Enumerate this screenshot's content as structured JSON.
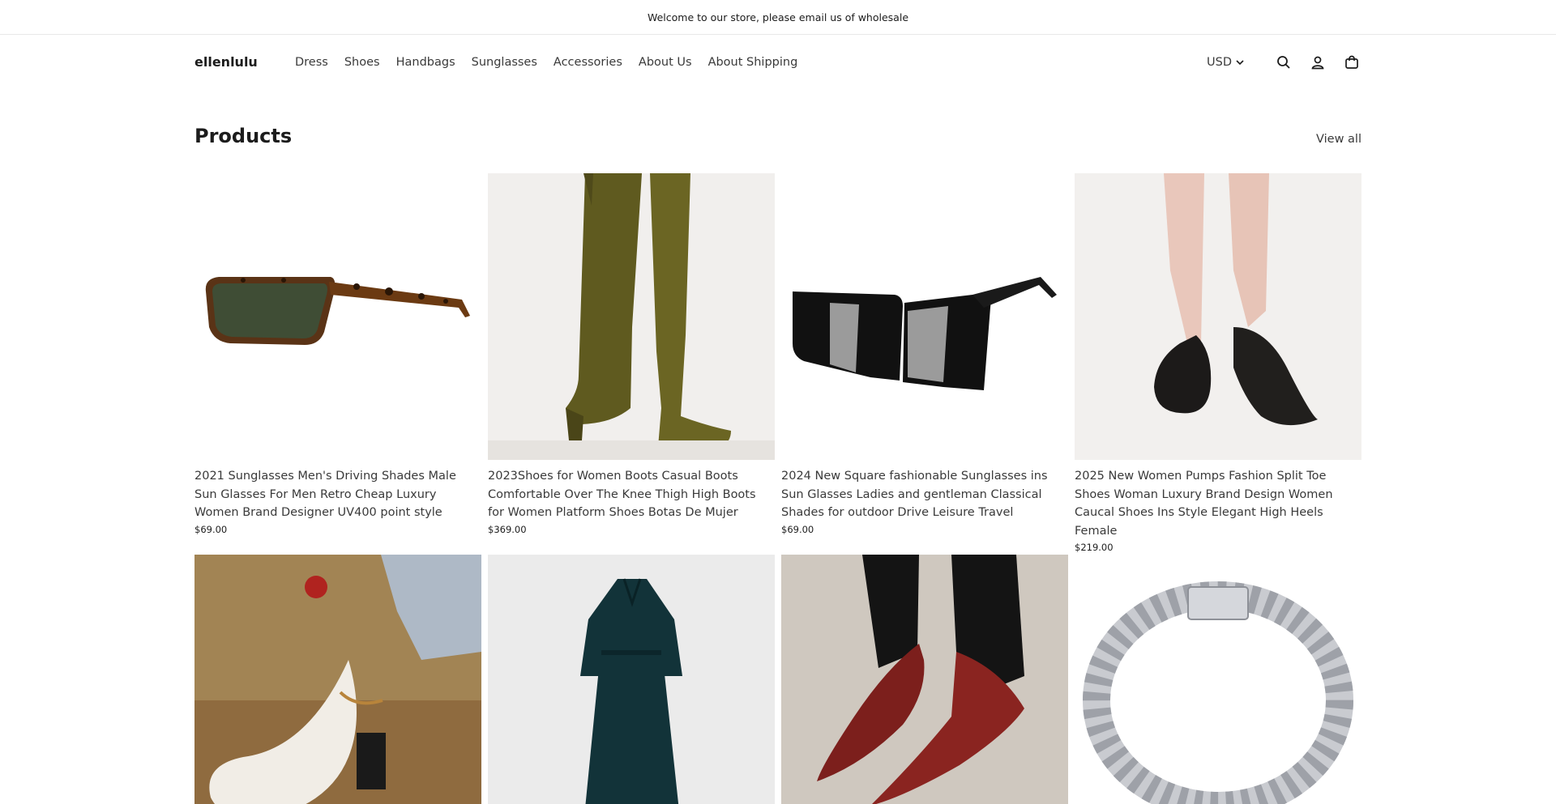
{
  "announcement": {
    "text": "Welcome to our store, please email us of wholesale"
  },
  "header": {
    "logo": "ellenlulu",
    "nav": [
      "Dress",
      "Shoes",
      "Handbags",
      "Sunglasses",
      "Accessories",
      "About Us",
      "About Shipping"
    ],
    "currency": "USD",
    "icons": [
      "search-icon",
      "account-icon",
      "cart-icon"
    ]
  },
  "section": {
    "title": "Products",
    "view_all": "View all"
  },
  "products": [
    {
      "title": "2021 Sunglasses Men's Driving Shades Male Sun Glasses For Men Retro Cheap Luxury Women Brand Designer UV400 point style",
      "price": "$69.00"
    },
    {
      "title": "2023Shoes for Women Boots Casual Boots Comfortable Over The Knee Thigh High Boots for Women Platform Shoes Botas De Mujer",
      "price": "$369.00"
    },
    {
      "title": "2024 New Square fashionable Sunglasses ins Sun Glasses Ladies and gentleman Classical Shades for outdoor Drive Leisure Travel",
      "price": "$69.00"
    },
    {
      "title": "2025 New Women Pumps Fashion Split Toe Shoes Woman Luxury Brand Design Women Caucal Shoes Ins Style Elegant High Heels Female",
      "price": "$219.00"
    },
    {
      "title": "",
      "price": ""
    },
    {
      "title": "",
      "price": ""
    },
    {
      "title": "",
      "price": ""
    },
    {
      "title": "",
      "price": ""
    }
  ]
}
